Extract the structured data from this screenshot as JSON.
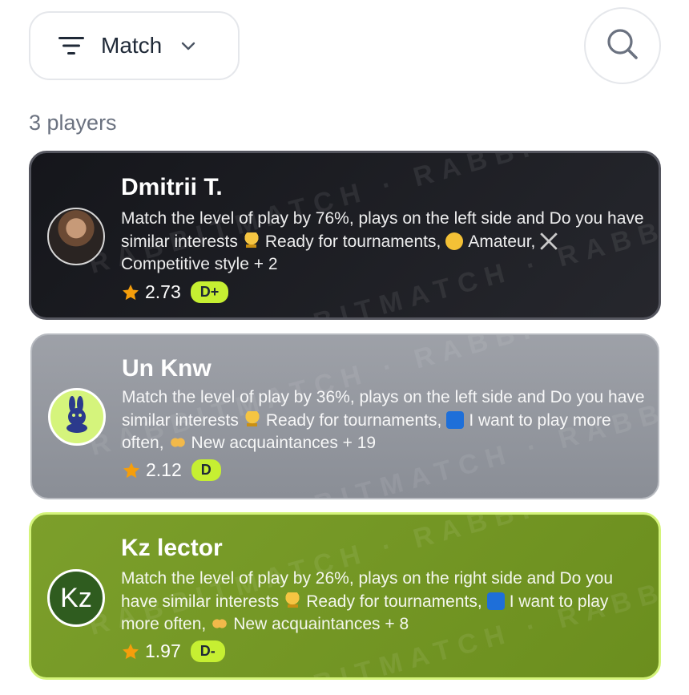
{
  "filter": {
    "label": "Match"
  },
  "players_count": "3 players",
  "players": [
    {
      "name": "Dmitrii T.",
      "desc_parts": [
        "Match the level of play by 76%, plays on the left side and Do you have similar interests",
        "Ready for tournaments,",
        "Amateur,",
        "Competitive style + 2"
      ],
      "rating": "2.73",
      "grade": "D+"
    },
    {
      "name": "Un Knw",
      "desc_parts": [
        "Match the level of play by 36%, plays on the left side and Do you have similar interests",
        "Ready for tournaments,",
        "I want to play more often,",
        "New acquaintances + 19"
      ],
      "rating": "2.12",
      "grade": "D"
    },
    {
      "name": "Kz lector",
      "avatar_initials": "Kz",
      "desc_parts": [
        "Match the level of play by 26%, plays on the right side and Do you have similar interests",
        "Ready for tournaments,",
        "I want to play more often,",
        "New acquaintances + 8"
      ],
      "rating": "1.97",
      "grade": "D-"
    }
  ],
  "watermark": "RABBITMATCH · RABBITMATCH"
}
